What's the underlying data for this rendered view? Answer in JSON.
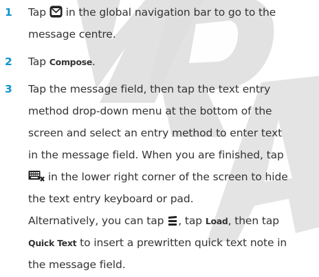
{
  "colors": {
    "step_number": "#0f94cc",
    "text": "#333333",
    "watermark": "#dedede"
  },
  "steps": [
    {
      "number": "1",
      "line1_a": "Tap",
      "line1_icon": "message-envelope-icon",
      "line1_b": "in the global navigation bar to go to the",
      "line2": "message centre."
    },
    {
      "number": "2",
      "a": "Tap",
      "bold": "Compose",
      "b": "."
    },
    {
      "number": "3",
      "lines": [
        "Tap the message field, then tap the text entry",
        "method drop-down menu at the bottom of the",
        "screen and select an entry method to enter text",
        "in the message field. When you are finished, tap"
      ],
      "line5_icon": "hide-keyboard-icon",
      "line5_text": "in the lower right corner of the screen to hide",
      "line6": "the text entry keyboard or pad.",
      "line7_a": "Alternatively, you can tap",
      "line7_icon": "menu-icon",
      "line7_b": ", tap",
      "line7_bold": "Load",
      "line7_c": ", then tap",
      "line8_bold": "Quick Text",
      "line8_text": "to insert a prewritten quick text note in",
      "line9": "the message field."
    }
  ]
}
